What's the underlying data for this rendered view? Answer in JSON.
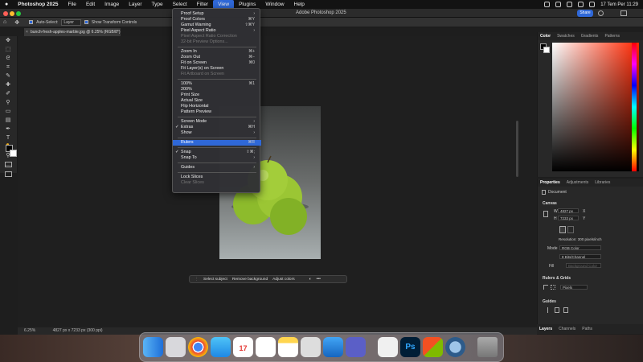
{
  "menubar": {
    "app_name": "Photoshop 2025",
    "items": [
      "File",
      "Edit",
      "Image",
      "Layer",
      "Type",
      "Select",
      "Filter",
      "View",
      "Plugins",
      "Window",
      "Help"
    ],
    "clock": "17 Tem Per  11:29"
  },
  "titlebar": {
    "title": "Adobe Photoshop 2025",
    "share_label": "Share"
  },
  "options": {
    "auto_select": "Auto-Select:",
    "layer_value": "Layer",
    "transform_controls": "Show Transform Controls"
  },
  "document": {
    "tab_title": "bunch-fresh-apples-marble.jpg @ 6.25% (RGB/8*)"
  },
  "view_menu": {
    "items": [
      {
        "label": "Proof Setup",
        "shortcut": "",
        "submenu": true,
        "disabled": false
      },
      {
        "label": "Proof Colors",
        "shortcut": "⌘Y",
        "disabled": false
      },
      {
        "label": "Gamut Warning",
        "shortcut": "⇧⌘Y",
        "disabled": false
      },
      {
        "label": "Pixel Aspect Ratio",
        "shortcut": "",
        "submenu": true,
        "disabled": false
      },
      {
        "label": "Pixel Aspect Ratio Correction",
        "shortcut": "",
        "disabled": true
      },
      {
        "label": "32-bit Preview Options...",
        "shortcut": "",
        "disabled": true
      },
      {
        "label": "Zoom In",
        "shortcut": "⌘+",
        "disabled": false
      },
      {
        "label": "Zoom Out",
        "shortcut": "⌘−",
        "disabled": false
      },
      {
        "label": "Fit on Screen",
        "shortcut": "⌘0",
        "disabled": false
      },
      {
        "label": "Fit Layer(s) on Screen",
        "shortcut": "",
        "disabled": false
      },
      {
        "label": "Fit Artboard on Screen",
        "shortcut": "",
        "disabled": true
      },
      {
        "label": "100%",
        "shortcut": "⌘1",
        "disabled": false
      },
      {
        "label": "200%",
        "shortcut": "",
        "disabled": false
      },
      {
        "label": "Print Size",
        "shortcut": "",
        "disabled": false
      },
      {
        "label": "Actual Size",
        "shortcut": "",
        "disabled": false
      },
      {
        "label": "Flip Horizontal",
        "shortcut": "",
        "disabled": false
      },
      {
        "label": "Pattern Preview",
        "shortcut": "",
        "disabled": false
      },
      {
        "label": "Screen Mode",
        "shortcut": "",
        "submenu": true,
        "disabled": false
      },
      {
        "label": "Extras",
        "shortcut": "⌘H",
        "checked": true,
        "disabled": false
      },
      {
        "label": "Show",
        "shortcut": "",
        "submenu": true,
        "disabled": false
      },
      {
        "label": "Rulers",
        "shortcut": "⌘R",
        "highlighted": true,
        "disabled": false
      },
      {
        "label": "Snap",
        "shortcut": "⇧⌘;",
        "checked": true,
        "disabled": false
      },
      {
        "label": "Snap To",
        "shortcut": "",
        "submenu": true,
        "disabled": false
      },
      {
        "label": "Guides",
        "shortcut": "",
        "submenu": true,
        "disabled": false
      },
      {
        "label": "Lock Slices",
        "shortcut": "",
        "disabled": false
      },
      {
        "label": "Clear Slices",
        "shortcut": "",
        "disabled": true
      }
    ]
  },
  "contextual_bar": {
    "select_subject": "Select subject",
    "remove_background": "Remove background",
    "adjust_colors": "Adjust colors"
  },
  "status": {
    "zoom": "6.25%",
    "doc_size": "4827 px x 7233 px (300 ppi)"
  },
  "color_panel": {
    "tabs": [
      "Color",
      "Swatches",
      "Gradients",
      "Patterns"
    ]
  },
  "properties": {
    "tabs": [
      "Properties",
      "Adjustments",
      "Libraries"
    ],
    "doc_label": "Document",
    "canvas_title": "Canvas",
    "width_label": "W",
    "width": "4827 px",
    "height_label": "H",
    "height": "7233 px",
    "x_label": "X",
    "y_label": "Y",
    "resolution": "Resolution: 300 pixels/inch",
    "mode_label": "Mode",
    "mode": "RGB Color",
    "depth": "8 Bits/Channel",
    "fill_label": "Fill",
    "fill_value": "Background Color",
    "rulers_title": "Rulers & Grids",
    "units": "Pixels",
    "guides_title": "Guides"
  },
  "layers_panel": {
    "tabs": [
      "Layers",
      "Channels",
      "Paths"
    ]
  },
  "colors": {
    "accent": "#2f68d8",
    "menu_bg": "#303034"
  }
}
